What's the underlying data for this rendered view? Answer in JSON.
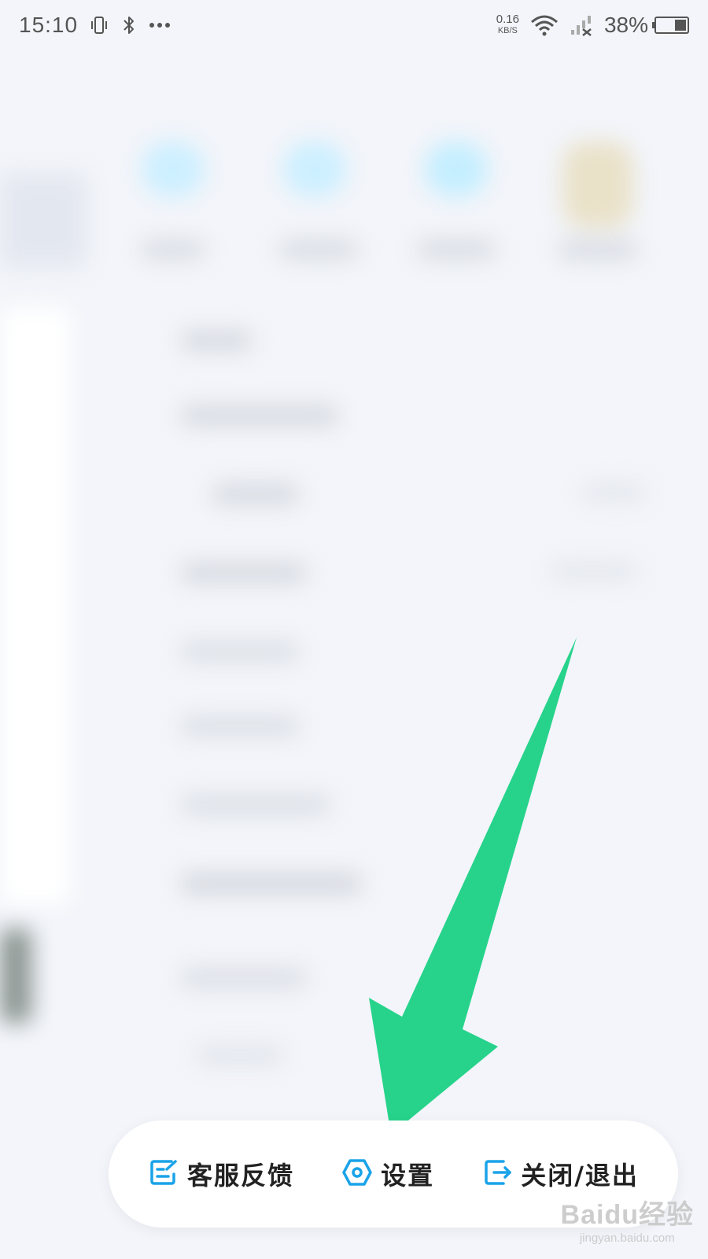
{
  "status_bar": {
    "time": "15:10",
    "net_speed_value": "0.16",
    "net_speed_unit": "KB/S",
    "battery_percent": "38%",
    "battery_level": 0.38
  },
  "bottom_menu": {
    "items": [
      {
        "label": "客服反馈",
        "icon": "feedback-edit-icon"
      },
      {
        "label": "设置",
        "icon": "settings-hexagon-icon"
      },
      {
        "label": "关闭/退出",
        "icon": "exit-icon"
      }
    ]
  },
  "colors": {
    "accent_icon": "#1aa3e8",
    "arrow": "#27d38b",
    "background": "#f3f5fa"
  },
  "watermark": {
    "brand": "Baidu经验",
    "url": "jingyan.baidu.com"
  }
}
